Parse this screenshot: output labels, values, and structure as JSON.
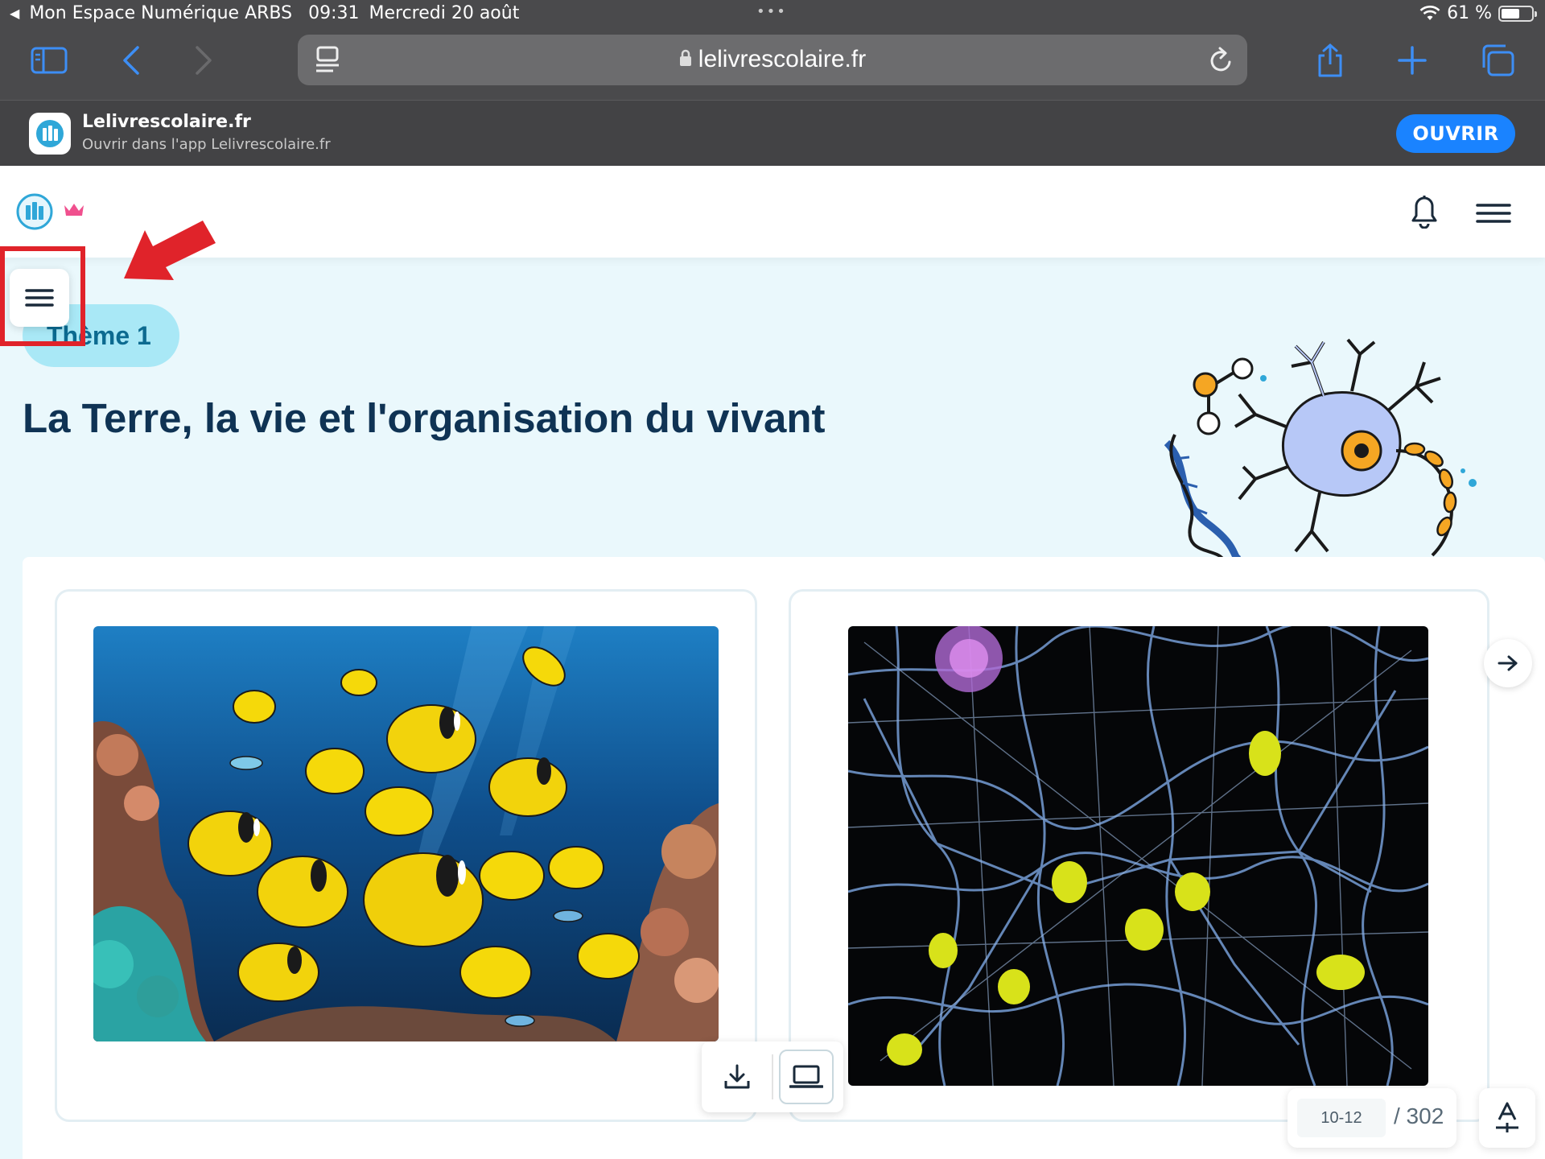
{
  "status_bar": {
    "back_app": "Mon Espace Numérique ARBS",
    "time": "09:31",
    "date": "Mercredi 20 août",
    "battery": "61 %",
    "battery_level": 0.61
  },
  "browser": {
    "url": "lelivrescolaire.fr",
    "icons": [
      "sidebar-icon",
      "back-icon",
      "forward-icon",
      "reader-icon",
      "lock-icon",
      "reload-icon",
      "share-icon",
      "new-tab-icon",
      "tabs-icon"
    ]
  },
  "app_banner": {
    "name": "Lelivrescolaire.fr",
    "subtitle": "Ouvrir dans l'app Lelivrescolaire.fr",
    "open_label": "OUVRIR"
  },
  "header": {
    "icons": [
      "logo-icon",
      "crown-icon",
      "bell-icon",
      "menu-icon"
    ]
  },
  "content": {
    "theme_label": "Thème 1",
    "title": "La Terre, la vie et l'organisation du vivant"
  },
  "pagination": {
    "current": "10-12",
    "total": "/ 302"
  },
  "colors": {
    "accent": "#1a83ff",
    "title": "#0f3354",
    "pill": "#a9e8f6",
    "background": "#eaf8fc",
    "highlight": "#e0232a"
  }
}
